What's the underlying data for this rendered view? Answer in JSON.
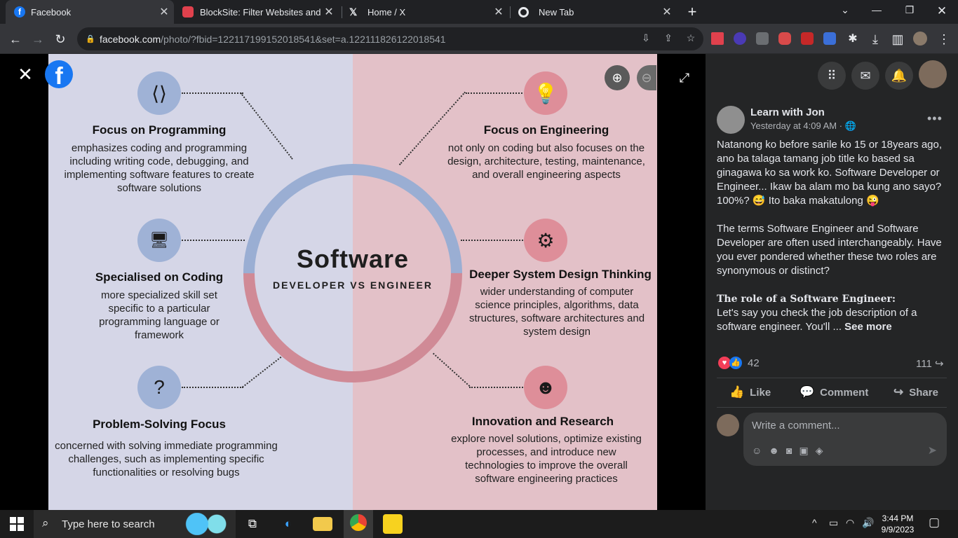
{
  "browser": {
    "tabs": [
      {
        "title": "Facebook",
        "active": true,
        "icon": "facebook-icon"
      },
      {
        "title": "BlockSite: Filter Websites and Co",
        "active": false,
        "icon": "blocksite-icon"
      },
      {
        "title": "Home / X",
        "active": false,
        "icon": "x-icon"
      },
      {
        "title": "New Tab",
        "active": false,
        "icon": "chrome-icon"
      }
    ],
    "url_host": "facebook.com",
    "url_path": "/photo/?fbid=122117199152018541&set=a.122111826122018541"
  },
  "infographic": {
    "title": "Software",
    "subtitle": "DEVELOPER VS ENGINEER",
    "colors": {
      "left_bg": "#d5d6e7",
      "right_bg": "#e3c1c8",
      "left_ring": "#9aaed3",
      "right_ring": "#d08a96"
    },
    "left": [
      {
        "heading": "Focus on Programming",
        "desc": "emphasizes coding and programming including writing code, debugging, and implementing software features to create software solutions",
        "icon": "code-brackets-icon"
      },
      {
        "heading": "Specialised on Coding",
        "desc": "more specialized skill set specific to a particular programming language or framework",
        "icon": "monitor-code-icon"
      },
      {
        "heading": "Problem-Solving Focus",
        "desc": "concerned with solving immediate programming challenges, such as implementing specific functionalities or resolving bugs",
        "icon": "question-gear-icon"
      }
    ],
    "right": [
      {
        "heading": "Focus on Engineering",
        "desc": "not only on coding but also focuses on the design, architecture, testing, maintenance, and overall engineering aspects",
        "icon": "lightbulb-icon"
      },
      {
        "heading": "Deeper System Design Thinking",
        "desc": "wider understanding of computer science principles, algorithms, data structures, software architectures and system design",
        "icon": "gear-tools-icon"
      },
      {
        "heading": "Innovation and Research",
        "desc": "explore novel solutions, optimize existing processes, and introduce new technologies to improve the overall software engineering practices",
        "icon": "head-brain-icon"
      }
    ]
  },
  "post": {
    "author": "Learn with Jon",
    "time": "Yesterday at 4:09 AM · ",
    "para1": "Natanong ko before sarile ko 15 or 18years ago, ano ba talaga tamang job title ko based sa ginagawa ko sa work ko. Software Developer or Engineer... Ikaw ba alam mo ba kung ano sayo? 100%? 😅 Ito baka makatulong 😜",
    "para2": "The terms Software Engineer and Software Developer are often used interchangeably. Have you ever pondered whether these two roles are synonymous or distinct?",
    "para3_heading": "𝐓𝐡𝐞 𝐫𝐨𝐥𝐞 𝐨𝐟 𝐚 𝐒𝐨𝐟𝐭𝐰𝐚𝐫𝐞 𝐄𝐧𝐠𝐢𝐧𝐞𝐞𝐫:",
    "para3": "Let's say you check the job description of a software engineer. You'll ... ",
    "see_more": "See more",
    "reactions_count": "42",
    "shares_count": "111",
    "actions": {
      "like": "Like",
      "comment": "Comment",
      "share": "Share"
    },
    "comment_placeholder": "Write a comment..."
  },
  "taskbar": {
    "search_placeholder": "Type here to search",
    "time": "3:44 PM",
    "date": "9/9/2023"
  }
}
